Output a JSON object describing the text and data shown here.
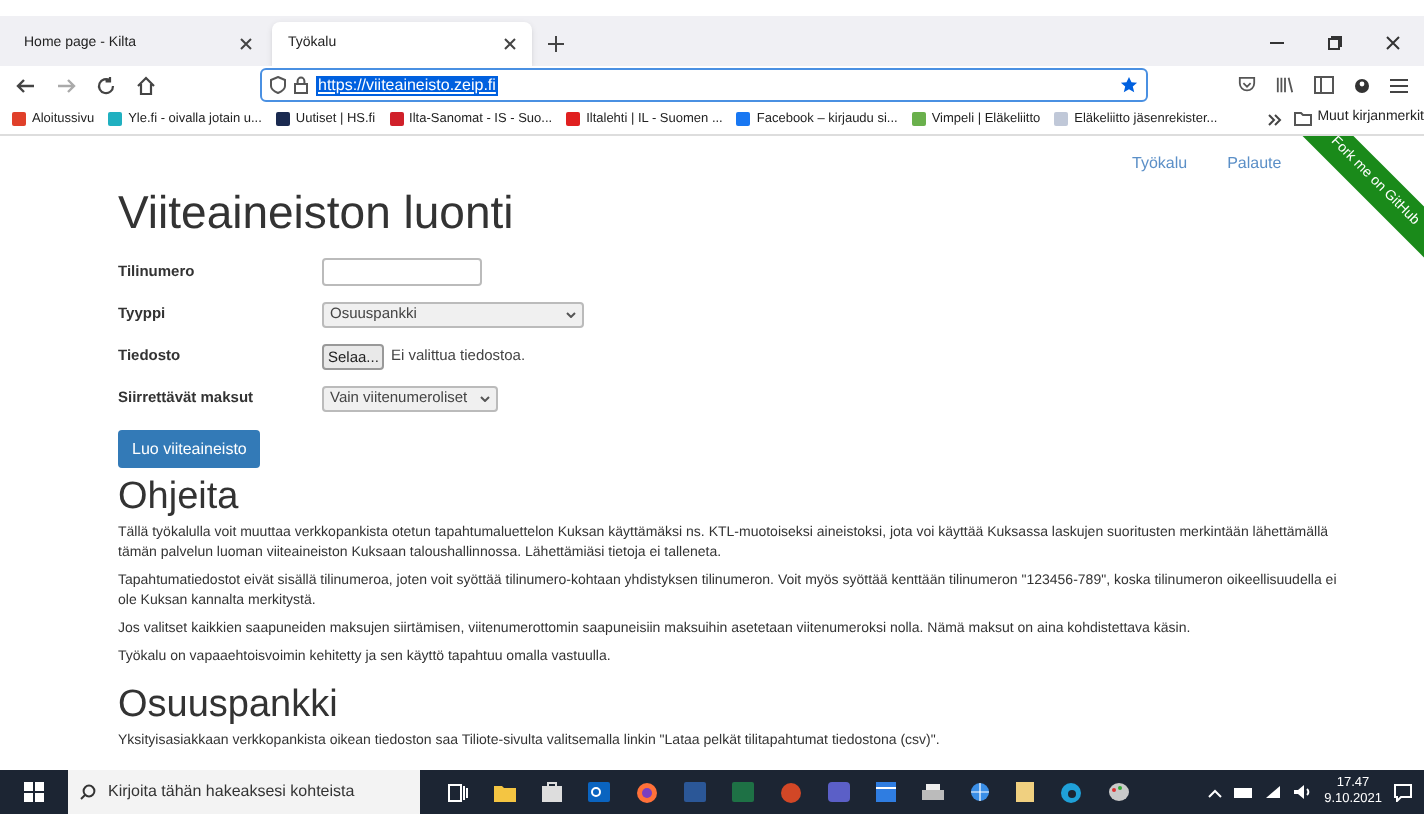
{
  "browser": {
    "tabs": [
      {
        "title": "Home page - Kilta",
        "selected": false
      },
      {
        "title": "Työkalu",
        "selected": true
      }
    ],
    "url": "https://viiteaineisto.zeip.fi",
    "bookmarks": [
      {
        "label": "Aloitussivu",
        "color": "#e0402a"
      },
      {
        "label": "Yle.fi - oivalla jotain u...",
        "color": "#20b0c0"
      },
      {
        "label": "Uutiset | HS.fi",
        "color": "#1a2a50"
      },
      {
        "label": "Ilta-Sanomat - IS - Suo...",
        "color": "#d0202a"
      },
      {
        "label": "Iltalehti | IL - Suomen ...",
        "color": "#e02020"
      },
      {
        "label": "Facebook – kirjaudu si...",
        "color": "#1877f2"
      },
      {
        "label": "Vimpeli | Eläkeliitto",
        "color": "#6ab04c"
      },
      {
        "label": "Eläkeliitto jäsenrekister...",
        "color": "#c0c8d8"
      }
    ],
    "other_bookmarks": "Muut kirjanmerkit"
  },
  "page": {
    "nav_links": [
      "Työkalu",
      "Palaute"
    ],
    "ribbon": "Fork me on GitHub",
    "title": "Viiteaineiston luonti",
    "form": [
      {
        "kind": "text",
        "label": "Tilinumero"
      },
      {
        "kind": "select",
        "label": "Tyyppi",
        "value": "Osuuspankki"
      },
      {
        "kind": "file",
        "label": "Tiedosto",
        "button": "Selaa...",
        "value": "Ei valittua tiedostoa."
      },
      {
        "kind": "select",
        "label": "Siirrettävät maksut",
        "value": "Vain viitenumeroliset"
      }
    ],
    "submit": "Luo viiteaineisto",
    "sections": [
      {
        "heading": "Ohjeita",
        "paragraphs": [
          "Tällä työkalulla voit muuttaa verkkopankista otetun tapahtumaluettelon Kuksan käyttämäksi ns. KTL-muotoiseksi aineistoksi, jota voi käyttää Kuksassa laskujen suoritusten merkintään lähettämällä tämän palvelun luoman viiteaineiston Kuksaan taloushallinnossa. Lähettämiäsi tietoja ei talleneta.",
          "Tapahtumatiedostot eivät sisällä tilinumeroa, joten voit syöttää tilinumero-kohtaan yhdistyksen tilinumeron. Voit myös syöttää kenttään tilinumeron \"123456-789\", koska tilinumeron oikeellisuudella ei ole Kuksan kannalta merkitystä.",
          "Jos valitset kaikkien saapuneiden maksujen siirtämisen, viitenumerottomin saapuneisiin maksuihin asetetaan viitenumeroksi nolla. Nämä maksut on aina kohdistettava käsin.",
          "Työkalu on vapaaehtoisvoimin kehitetty ja sen käyttö tapahtuu omalla vastuulla."
        ]
      },
      {
        "heading": "Osuuspankki",
        "paragraphs": [
          "Yksityisasiakkaan verkkopankista oikean tiedoston saa Tiliote-sivulta valitsemalla linkin \"Lataa pelkät tilitapahtumat tiedostona (csv)\"."
        ]
      }
    ]
  },
  "taskbar": {
    "search_placeholder": "Kirjoita tähän hakeaksesi kohteista",
    "time": "17.47",
    "date": "9.10.2021"
  }
}
